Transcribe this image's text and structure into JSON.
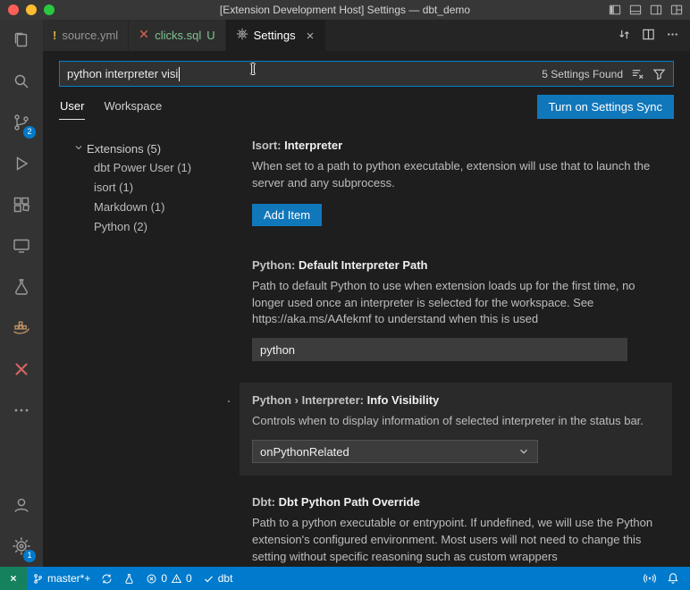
{
  "titlebar": {
    "title": "[Extension Development Host] Settings — dbt_demo"
  },
  "editor_tabs": [
    {
      "label": "source.yml",
      "badge": ""
    },
    {
      "label": "clicks.sql",
      "badge": "U"
    },
    {
      "label": "Settings",
      "badge": ""
    }
  ],
  "icons": {
    "warning_file": "!"
  },
  "search": {
    "value": "python interpreter visi",
    "results_count": "5 Settings Found"
  },
  "scope": {
    "tabs": [
      "User",
      "Workspace"
    ],
    "sync_button": "Turn on Settings Sync"
  },
  "toc": {
    "root": "Extensions (5)",
    "children": [
      "dbt Power User (1)",
      "isort (1)",
      "Markdown (1)",
      "Python (2)"
    ]
  },
  "settings": [
    {
      "category": "Isort:",
      "name": "Interpreter",
      "description": "When set to a path to python executable, extension will use that to launch the server and any subprocess.",
      "button": "Add Item"
    },
    {
      "category": "Python:",
      "name": "Default Interpreter Path",
      "description": "Path to default Python to use when extension loads up for the first time, no longer used once an interpreter is selected for the workspace. See https://aka.ms/AAfekmf to understand when this is used",
      "value": "python"
    },
    {
      "category": "Python › Interpreter:",
      "name": "Info Visibility",
      "description": "Controls when to display information of selected interpreter in the status bar.",
      "value": "onPythonRelated"
    },
    {
      "category": "Dbt:",
      "name": "Dbt Python Path Override",
      "description": "Path to a python executable or entrypoint. If undefined, we will use the Python extension's configured environment. Most users will not need to change this setting without specific reasoning such as custom wrappers"
    }
  ],
  "activity_bar": {
    "items": [
      "explorer",
      "search",
      "source-control",
      "run-and-debug",
      "extensions",
      "remote-explorer",
      "testing",
      "extension-docker",
      "extension-x",
      "more"
    ],
    "scm_badge": "2",
    "manage_badge": "1"
  },
  "statusbar": {
    "branch": "master*+",
    "errors": "0",
    "warnings": "0",
    "dbt_label": "dbt"
  },
  "colors": {
    "accent_button": "#1177bb",
    "statusbar": "#007acc",
    "focus_border": "#007fd4",
    "remote_indicator": "#16825d",
    "badge": "#007acc"
  }
}
